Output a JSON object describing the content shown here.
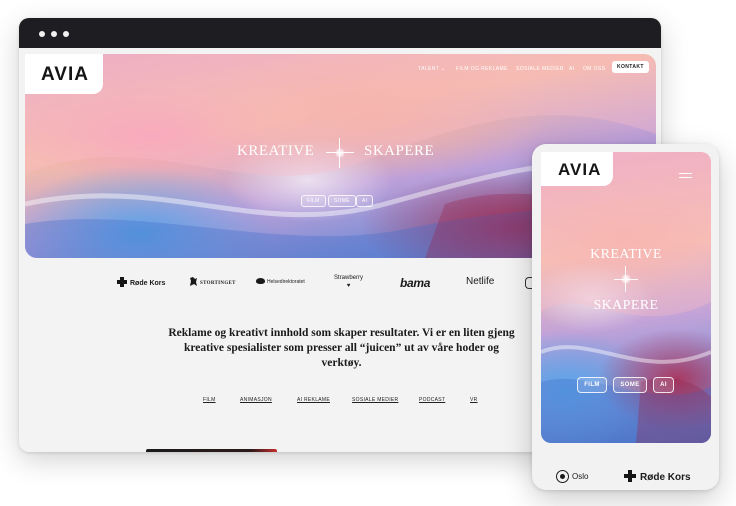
{
  "brand": {
    "logo": "AVIA"
  },
  "desktop": {
    "nav": {
      "talent": "TALENT ⌄",
      "film": "FILM OG REKLAME",
      "some": "SOSIALE MEDIER",
      "ai": "AI",
      "omoss": "OM OSS",
      "kontakt": "KONTAKT"
    },
    "hero": {
      "title_left": "KREATIVE",
      "title_right": "SKAPERE",
      "pills": [
        "FILM",
        "SOME",
        "AI"
      ]
    },
    "clients": {
      "rodekors": "Røde Kors",
      "stortinget": "STORTINGET",
      "helse": "Helsedirektoratet",
      "strawberry": "Strawberry",
      "bama": "bama",
      "netlife": "Netlife"
    },
    "lead": "Reklame og kreativt innhold som skaper resultater. Vi er en liten gjeng kreative spesialister som presser all “juicen” ut av våre hoder og verktøy.",
    "categories": {
      "film": "FILM",
      "animasjon": "ANIMASJON",
      "ai": "AI REKLAME",
      "some": "SOSIALE MEDIER",
      "podcast": "PODCAST",
      "vr": "VR"
    }
  },
  "mobile": {
    "hero": {
      "title_top": "KREATIVE",
      "title_bottom": "SKAPERE",
      "pills": [
        "FILM",
        "SOME",
        "AI"
      ]
    },
    "clients": {
      "oslo": "Oslo",
      "rodekors": "Røde Kors"
    }
  },
  "colors": {
    "dark_bar": "#1e1d22",
    "ink": "#1a1a1a",
    "page": "#f3f3f3"
  }
}
